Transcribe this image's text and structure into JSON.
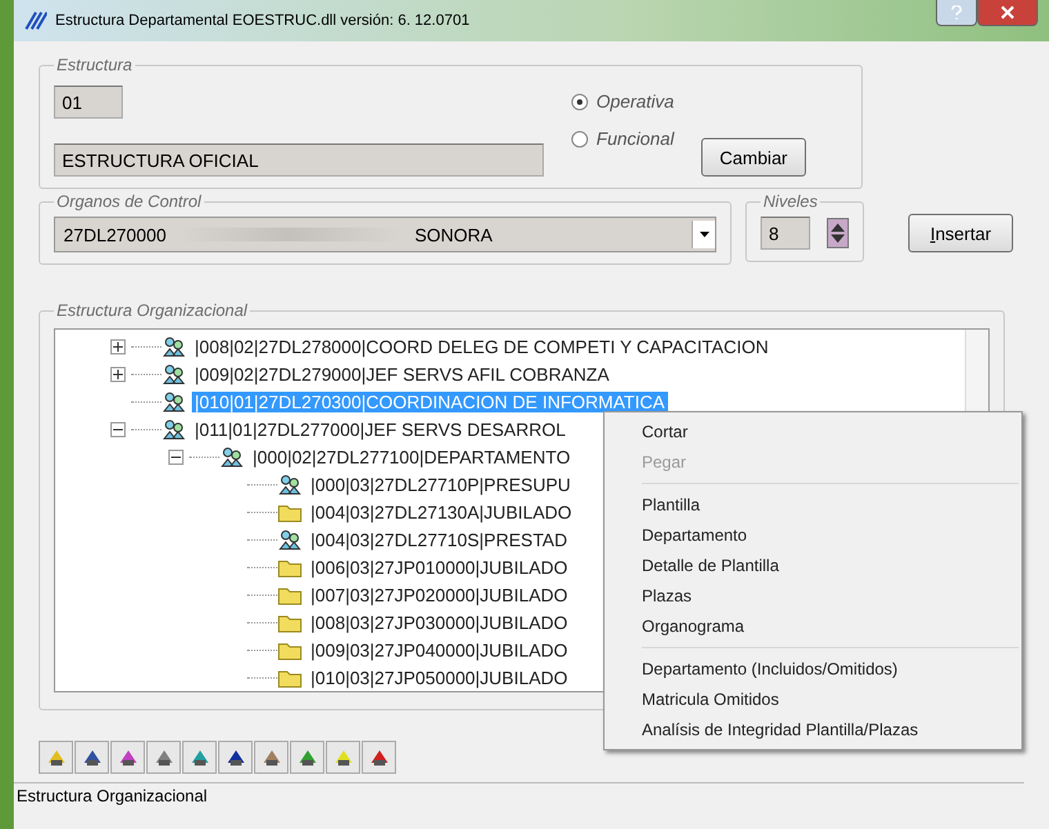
{
  "window": {
    "title": "Estructura Departamental EOESTRUC.dll  versión: 6. 12.0701"
  },
  "estructura": {
    "label": "Estructura",
    "code": "01",
    "name": "ESTRUCTURA OFICIAL",
    "options": [
      {
        "label": "Operativa",
        "selected": true
      },
      {
        "label": "Funcional",
        "selected": false
      }
    ],
    "button": "Cambiar"
  },
  "organos": {
    "label": "Organos de Control",
    "value_start": "27DL270000",
    "value_end": "SONORA"
  },
  "niveles": {
    "label": "Niveles",
    "value": "8"
  },
  "insert_button": "Insertar",
  "tree": {
    "label": "Estructura Organizacional",
    "items": [
      {
        "text": "|008|02|27DL278000|COORD DELEG DE COMPETI Y CAPACITACION",
        "kind": "group",
        "expanded": false,
        "selected": false
      },
      {
        "text": "|009|02|27DL279000|JEF SERVS AFIL COBRANZA",
        "kind": "group",
        "expanded": false,
        "selected": false
      },
      {
        "text": "|010|01|27DL270300|COORDINACION DE INFORMATICA",
        "kind": "group",
        "selected": true
      },
      {
        "text": "|011|01|27DL277000|JEF SERVS DESARROL",
        "kind": "group",
        "expanded": true,
        "selected": false,
        "children": [
          {
            "text": "|000|02|27DL277100|DEPARTAMENTO",
            "kind": "group",
            "expanded": true,
            "selected": false,
            "children": [
              {
                "text": "|000|03|27DL27710P|PRESUPU",
                "kind": "group",
                "selected": false
              },
              {
                "text": "|004|03|27DL27130A|JUBILADO",
                "kind": "folder",
                "selected": false
              },
              {
                "text": "|004|03|27DL27710S|PRESTAD",
                "kind": "group",
                "selected": false
              },
              {
                "text": "|006|03|27JP010000|JUBILADO",
                "kind": "folder",
                "selected": false
              },
              {
                "text": "|007|03|27JP020000|JUBILADO",
                "kind": "folder",
                "selected": false
              },
              {
                "text": "|008|03|27JP030000|JUBILADO",
                "kind": "folder",
                "selected": false
              },
              {
                "text": "|009|03|27JP040000|JUBILADO",
                "kind": "folder",
                "selected": false
              },
              {
                "text": "|010|03|27JP050000|JUBILADO",
                "kind": "folder",
                "selected": false
              }
            ]
          }
        ]
      }
    ]
  },
  "context_menu": [
    [
      {
        "label": "Cortar",
        "disabled": false
      },
      {
        "label": "Pegar",
        "disabled": true
      }
    ],
    [
      {
        "label": "Plantilla",
        "disabled": false
      },
      {
        "label": "Departamento",
        "disabled": false
      },
      {
        "label": "Detalle de Plantilla",
        "disabled": false
      },
      {
        "label": "Plazas",
        "disabled": false
      },
      {
        "label": "Organograma",
        "disabled": false
      }
    ],
    [
      {
        "label": "Departamento (Incluidos/Omitidos)",
        "disabled": false
      },
      {
        "label": "Matricula Omitidos",
        "disabled": false
      },
      {
        "label": "Analísis de Integridad Plantilla/Plazas",
        "disabled": false
      }
    ]
  ],
  "status_bar": "Estructura Organizacional"
}
